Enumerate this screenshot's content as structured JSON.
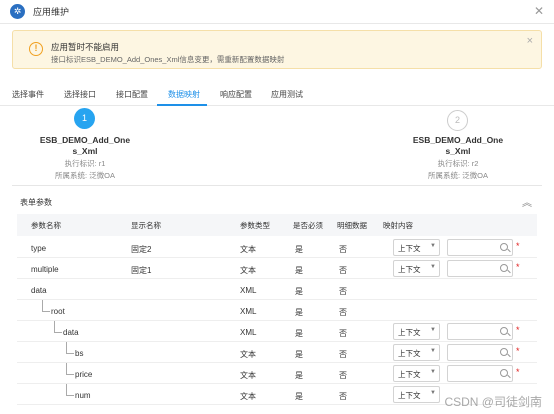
{
  "window": {
    "title": "应用维护",
    "logo_icon": "snowflake-icon"
  },
  "alert": {
    "title": "应用暂时不能启用",
    "description": "接口标识ESB_DEMO_Add_Ones_Xml信息变更，需重新配置数据映射",
    "icon": "warning-icon",
    "color": "#f0a020"
  },
  "tabs": [
    {
      "label": "选择事件",
      "active": false
    },
    {
      "label": "选择接口",
      "active": false
    },
    {
      "label": "接口配置",
      "active": false
    },
    {
      "label": "数据映射",
      "active": true
    },
    {
      "label": "响应配置",
      "active": false
    },
    {
      "label": "应用测试",
      "active": false
    }
  ],
  "steps": [
    {
      "number": "1",
      "name_line1": "ESB_DEMO_Add_One",
      "name_line2": "s_Xml",
      "exec_id": "执行标识: r1",
      "system": "所属系统: 泛微OA",
      "active": true
    },
    {
      "number": "2",
      "name_line1": "ESB_DEMO_Add_One",
      "name_line2": "s_Xml",
      "exec_id": "执行标识: r2",
      "system": "所属系统: 泛微OA",
      "active": false
    }
  ],
  "panel": {
    "title": "表单参数"
  },
  "table": {
    "headers": {
      "param_name": "参数名称",
      "display_name": "显示名称",
      "param_type": "参数类型",
      "required": "是否必须",
      "detail": "明细数据",
      "mapping": "映射内容"
    },
    "rows": [
      {
        "name": "type",
        "display": "固定2",
        "type": "文本",
        "required": "是",
        "detail": "否",
        "mapping": "上下文",
        "has_input": true,
        "depth": 0
      },
      {
        "name": "multiple",
        "display": "固定1",
        "type": "文本",
        "required": "是",
        "detail": "否",
        "mapping": "上下文",
        "has_input": true,
        "depth": 0
      },
      {
        "name": "data",
        "display": "",
        "type": "XML",
        "required": "是",
        "detail": "否",
        "mapping": "",
        "has_input": false,
        "depth": 0
      },
      {
        "name": "root",
        "display": "",
        "type": "XML",
        "required": "是",
        "detail": "否",
        "mapping": "",
        "has_input": false,
        "depth": 1
      },
      {
        "name": "data",
        "display": "",
        "type": "XML",
        "required": "是",
        "detail": "否",
        "mapping": "上下文",
        "has_input": true,
        "depth": 2
      },
      {
        "name": "bs",
        "display": "",
        "type": "文本",
        "required": "是",
        "detail": "否",
        "mapping": "上下文",
        "has_input": true,
        "depth": 3
      },
      {
        "name": "price",
        "display": "",
        "type": "文本",
        "required": "是",
        "detail": "否",
        "mapping": "上下文",
        "has_input": true,
        "depth": 3
      },
      {
        "name": "num",
        "display": "",
        "type": "文本",
        "required": "是",
        "detail": "否",
        "mapping": "上下文",
        "has_input": false,
        "depth": 3
      }
    ]
  },
  "watermark": "CSDN @司徒剑南",
  "colors": {
    "accent": "#1e90e8",
    "required": "#e02020",
    "warning_bg": "#fdf6e2"
  }
}
